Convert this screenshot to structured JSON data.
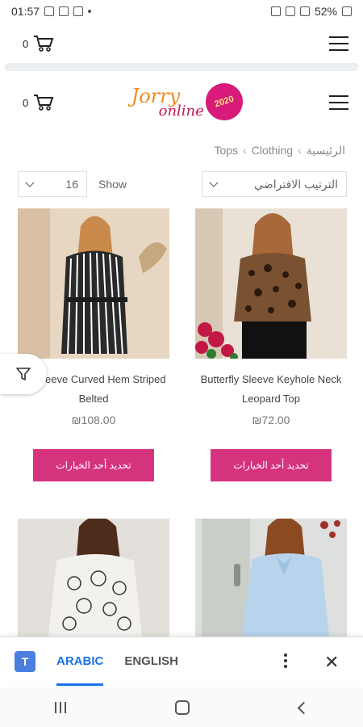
{
  "status_bar": {
    "time": "01:57",
    "battery": "52%"
  },
  "top_bar": {
    "cart_count": "0"
  },
  "header": {
    "cart_count": "0",
    "logo_line1": "Jorry",
    "logo_line2": "online",
    "logo_badge": "2020"
  },
  "breadcrumb": {
    "items": [
      "Tops",
      "Clothing",
      "الرئيسية"
    ]
  },
  "toolbar": {
    "per_page_value": "16",
    "show_label": "Show",
    "sort_value": "الترتيب الافتراضي"
  },
  "products": [
    {
      "title": "ng Sleeve Curved Hem Striped Belted",
      "price": "₪108.00",
      "button": "تحديد أحد الخيارات",
      "image": "woman-in-striped-dress"
    },
    {
      "title": "Butterfly Sleeve Keyhole Neck Leopard Top",
      "price": "₪72.00",
      "button": "تحديد أحد الخيارات",
      "image": "woman-in-leopard-top"
    },
    {
      "image": "woman-in-floral-print-top"
    },
    {
      "image": "woman-in-light-blue-bow-blouse"
    }
  ],
  "translate_bar": {
    "lang_active": "ARABIC",
    "lang_other": "ENGLISH",
    "logo": "T",
    "accent": "#1a73e8"
  },
  "colors": {
    "button": "#d6337f",
    "logo_orange": "#f08a24",
    "logo_pink": "#d81b7a"
  }
}
